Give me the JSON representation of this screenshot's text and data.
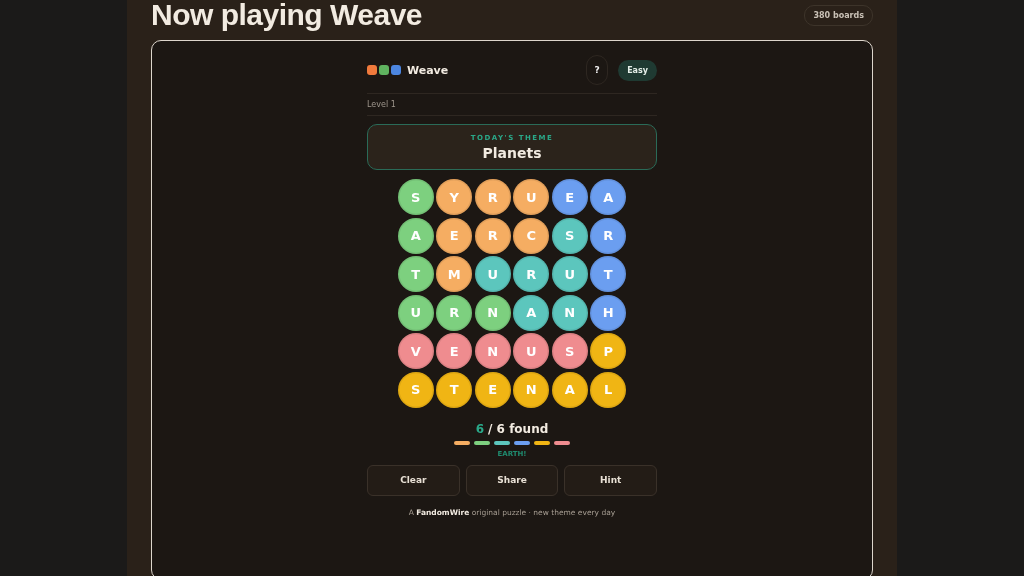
{
  "page": {
    "title": "Now playing Weave",
    "boards_badge": "380 boards"
  },
  "game": {
    "name": "Weave",
    "help_button": "?",
    "difficulty": "Easy",
    "level": "Level 1",
    "theme": {
      "label": "TODAY'S THEME",
      "value": "Planets"
    },
    "grid": [
      [
        {
          "letter": "S",
          "color": "#7dd07f"
        },
        {
          "letter": "Y",
          "color": "#f5ad62"
        },
        {
          "letter": "R",
          "color": "#f5ad62"
        },
        {
          "letter": "U",
          "color": "#f5ad62"
        },
        {
          "letter": "E",
          "color": "#6b9ef0"
        },
        {
          "letter": "A",
          "color": "#6b9ef0"
        }
      ],
      [
        {
          "letter": "A",
          "color": "#7dd07f"
        },
        {
          "letter": "E",
          "color": "#f5ad62"
        },
        {
          "letter": "R",
          "color": "#f5ad62"
        },
        {
          "letter": "C",
          "color": "#f5ad62"
        },
        {
          "letter": "S",
          "color": "#5cc6bd"
        },
        {
          "letter": "R",
          "color": "#6b9ef0"
        }
      ],
      [
        {
          "letter": "T",
          "color": "#7dd07f"
        },
        {
          "letter": "M",
          "color": "#f5ad62"
        },
        {
          "letter": "U",
          "color": "#5cc6bd"
        },
        {
          "letter": "R",
          "color": "#5cc6bd"
        },
        {
          "letter": "U",
          "color": "#5cc6bd"
        },
        {
          "letter": "T",
          "color": "#6b9ef0"
        }
      ],
      [
        {
          "letter": "U",
          "color": "#7dd07f"
        },
        {
          "letter": "R",
          "color": "#7dd07f"
        },
        {
          "letter": "N",
          "color": "#7dd07f"
        },
        {
          "letter": "A",
          "color": "#5cc6bd"
        },
        {
          "letter": "N",
          "color": "#5cc6bd"
        },
        {
          "letter": "H",
          "color": "#6b9ef0"
        }
      ],
      [
        {
          "letter": "V",
          "color": "#ef8c8f"
        },
        {
          "letter": "E",
          "color": "#ef8c8f"
        },
        {
          "letter": "N",
          "color": "#ef8c8f"
        },
        {
          "letter": "U",
          "color": "#ef8c8f"
        },
        {
          "letter": "S",
          "color": "#ef8c8f"
        },
        {
          "letter": "P",
          "color": "#f0b514"
        }
      ],
      [
        {
          "letter": "S",
          "color": "#f0b514"
        },
        {
          "letter": "T",
          "color": "#f0b514"
        },
        {
          "letter": "E",
          "color": "#f0b514"
        },
        {
          "letter": "N",
          "color": "#f0b514"
        },
        {
          "letter": "A",
          "color": "#f0b514"
        },
        {
          "letter": "L",
          "color": "#f0b514"
        }
      ]
    ],
    "progress": {
      "found": "6",
      "total": "/ 6 found",
      "segments": [
        {
          "color": "#f5ad62"
        },
        {
          "color": "#7dd07f"
        },
        {
          "color": "#5cc6bd"
        },
        {
          "color": "#6b9ef0"
        },
        {
          "color": "#f0b514"
        },
        {
          "color": "#ef8c8f"
        }
      ]
    },
    "message": "EARTH!",
    "buttons": [
      "Clear",
      "Share",
      "Hint"
    ],
    "footer": "A **FandomWire** original puzzle · new theme every day"
  }
}
